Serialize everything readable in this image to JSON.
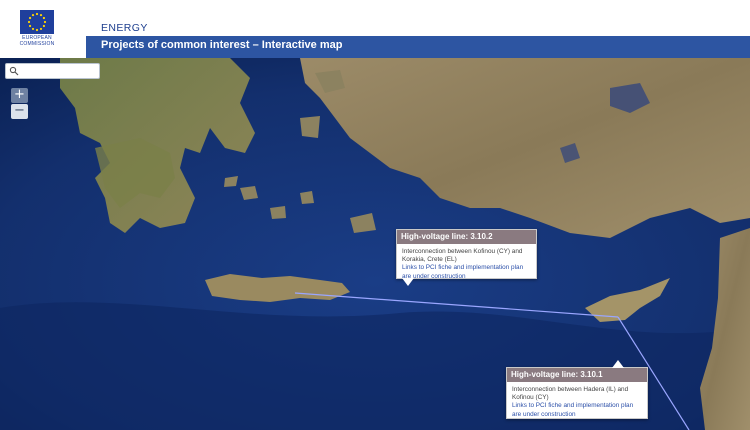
{
  "header": {
    "logo_text": "EUROPEAN COMMISSION",
    "dg_label": "ENERGY",
    "page_title": "Projects of common interest – Interactive map"
  },
  "search": {
    "placeholder": "",
    "value": ""
  },
  "zoom": {
    "in_label": "+",
    "out_label": "−"
  },
  "popups": [
    {
      "title": "High-voltage line: 3.10.2",
      "description": "Interconnection between Kofinou (CY) and Korakia, Crete (EL)",
      "links_text": "Links to PCI fiche and implementation plan are under construction"
    },
    {
      "title": "High-voltage line: 3.10.1",
      "description": "Interconnection between Hadera (IL) and Kofinou (CY)",
      "links_text": "Links to PCI fiche and implementation plan are under construction"
    }
  ],
  "colors": {
    "header_bar": "#2d55a2",
    "eu_flag": "#1f3f9c",
    "eu_star": "#ffd400",
    "sea": "#0f2a66",
    "land": "#8a7b5c",
    "interconnection_line": "#9aa6ff",
    "popup_header": "#8a7a80"
  }
}
